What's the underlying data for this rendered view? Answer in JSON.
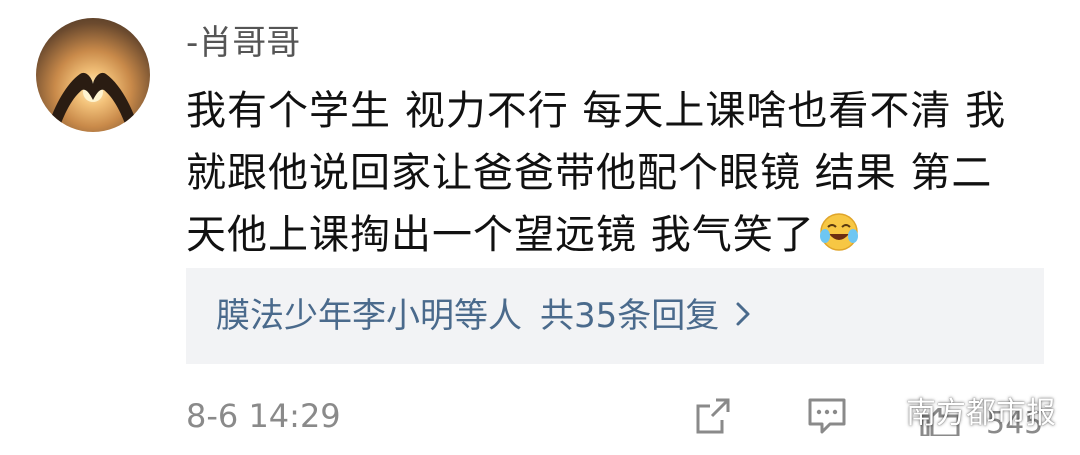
{
  "comment": {
    "username": "-肖哥哥",
    "text_lines": [
      "我有个学生 视力不行 每天上课啥也看不清 我",
      "就跟他说回家让爸爸带他配个眼镜 结果 第二",
      "天他上课掏出一个望远镜 我气笑了"
    ],
    "emoji": "laughing-crying-face"
  },
  "replies": {
    "names": "膜法少年李小明等人",
    "count_label": "共35条回复"
  },
  "footer": {
    "timestamp": "8-6 14:29",
    "like_count": "545"
  },
  "watermark": {
    "text": "南方都市报"
  },
  "colors": {
    "link": "#4a6a8c",
    "reply_bg": "#f2f3f5",
    "meta": "#8a8a8a"
  }
}
